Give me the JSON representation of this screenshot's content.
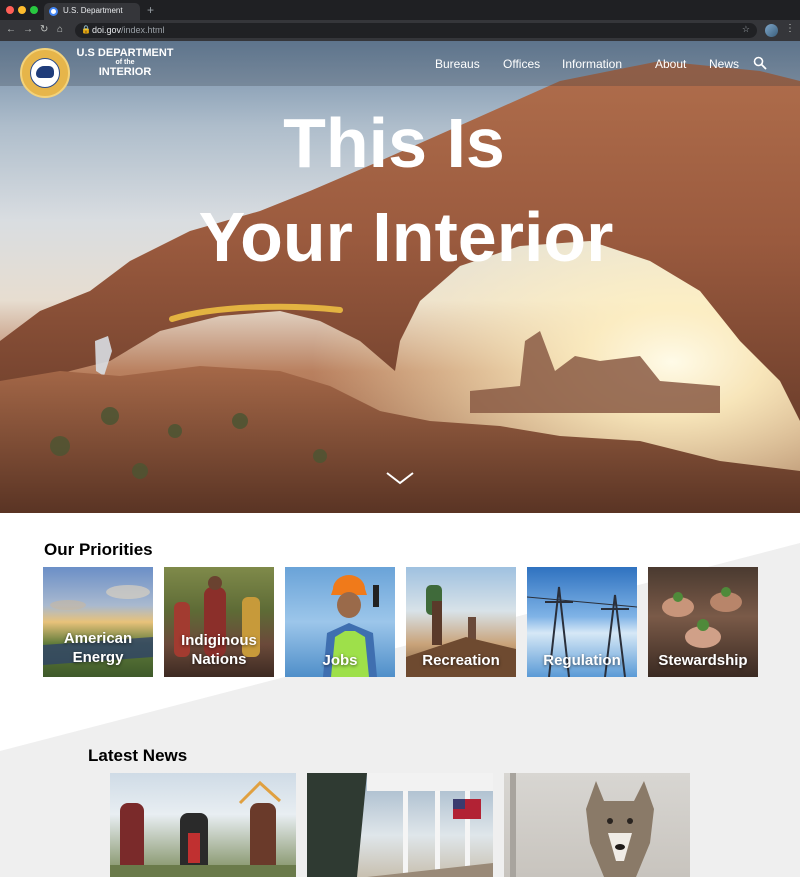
{
  "browser": {
    "tab_title": "U.S. Department",
    "new_tab": "+",
    "url_domain": "doi.gov",
    "url_path": "/index.html",
    "back_icon": "back-arrow-icon",
    "forward_icon": "forward-arrow-icon",
    "reload_icon": "reload-icon",
    "home_icon": "home-icon",
    "star_icon": "bookmark-star-icon",
    "menu_icon": "kebab-menu-icon"
  },
  "header": {
    "brand_line1": "U.S DEPARTMENT",
    "brand_line2": "of the",
    "brand_line3": "INTERIOR",
    "nav": [
      "Bureaus",
      "Offices",
      "Information",
      "About",
      "News"
    ],
    "search_icon": "search-icon"
  },
  "hero": {
    "title_line1": "This Is",
    "title_line2": "Your Interior",
    "scroll_icon": "chevron-down-icon",
    "accent_color": "#e3b341"
  },
  "priorities": {
    "heading": "Our Priorities",
    "cards": [
      {
        "label_line1": "American",
        "label_line2": "Energy"
      },
      {
        "label_line1": "Indiginous",
        "label_line2": "Nations"
      },
      {
        "label_line1": "",
        "label_line2": "Jobs"
      },
      {
        "label_line1": "",
        "label_line2": "Recreation"
      },
      {
        "label_line1": "",
        "label_line2": "Regulation"
      },
      {
        "label_line1": "",
        "label_line2": "Stewardship"
      }
    ]
  },
  "news": {
    "heading": "Latest News"
  },
  "colors": {
    "page_bg": "#ffffff",
    "gray_band": "#efefef",
    "chrome_dark": "#35363a"
  }
}
